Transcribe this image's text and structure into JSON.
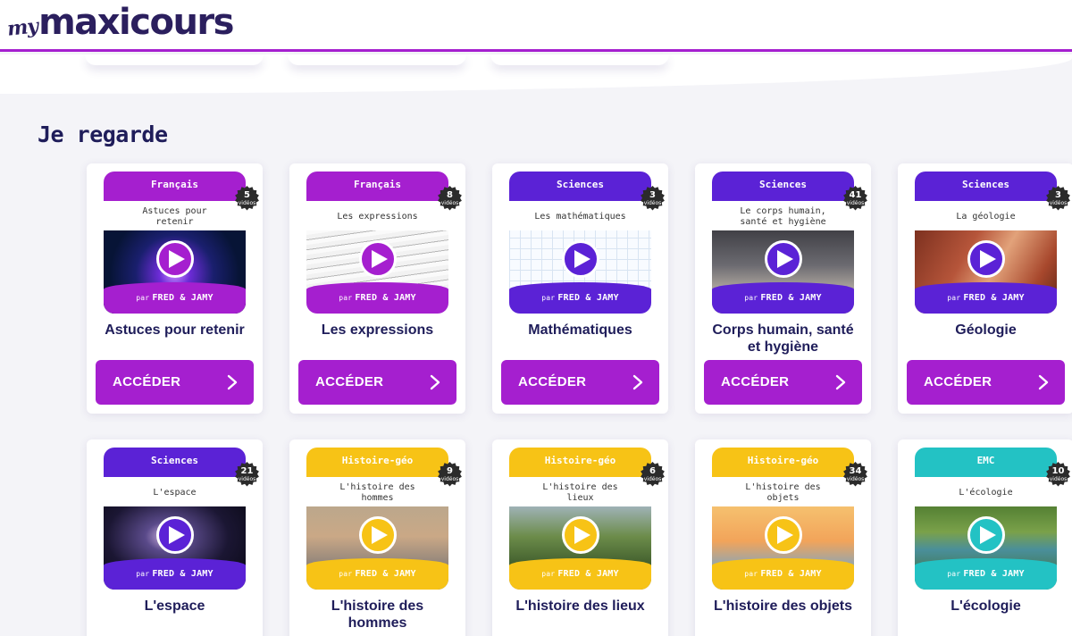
{
  "app": {
    "logo_prefix": "my",
    "logo_name": "maxicours"
  },
  "section": {
    "title": "Je regarde"
  },
  "common": {
    "cta_label": "ACCÉDER",
    "footer_par": "par",
    "footer_name": "FRED & JAMY",
    "videos_label": "vidéos"
  },
  "colors": {
    "brand_purple": "#a51fcf",
    "navy": "#1f1d5a",
    "sciences": "#5b22d6",
    "francais": "#a51fcf",
    "histoire_geo": "#f7c316",
    "emc": "#23c2c4"
  },
  "cards": [
    {
      "subject": "Français",
      "label": "Astuces pour retenir",
      "count": "5",
      "title": "Astuces pour retenir",
      "theme": "francais",
      "image": "brain"
    },
    {
      "subject": "Français",
      "label": "Les expressions",
      "count": "8",
      "title": "Les expressions",
      "theme": "francais",
      "image": "dictionary"
    },
    {
      "subject": "Sciences",
      "label": "Les mathématiques",
      "count": "3",
      "title": "Mathématiques",
      "theme": "sciences",
      "image": "math"
    },
    {
      "subject": "Sciences",
      "label": "Le corps humain, santé et hygiène",
      "count": "41",
      "title": "Corps humain, santé et hygiène",
      "theme": "sciences",
      "image": "yoga"
    },
    {
      "subject": "Sciences",
      "label": "La géologie",
      "count": "3",
      "title": "Géologie",
      "theme": "sciences",
      "image": "canyon"
    },
    {
      "subject": "Sciences",
      "label": "L'espace",
      "count": "21",
      "title": "L'espace",
      "theme": "sciences",
      "image": "space"
    },
    {
      "subject": "Histoire-géo",
      "label": "L'histoire des hommes",
      "count": "9",
      "title": "L'histoire des hommes",
      "theme": "histoire_geo",
      "image": "people"
    },
    {
      "subject": "Histoire-géo",
      "label": "L'histoire des lieux",
      "count": "6",
      "title": "L'histoire des lieux",
      "theme": "histoire_geo",
      "image": "wall"
    },
    {
      "subject": "Histoire-géo",
      "label": "L'histoire des objets",
      "count": "34",
      "title": "L'histoire des objets",
      "theme": "histoire_geo",
      "image": "balloons"
    },
    {
      "subject": "EMC",
      "label": "L'écologie",
      "count": "10",
      "title": "L'écologie",
      "theme": "emc",
      "image": "river"
    }
  ]
}
